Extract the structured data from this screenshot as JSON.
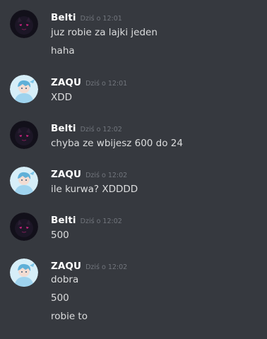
{
  "messages": [
    {
      "author": "Belti",
      "avatar": "dark-cat-avatar",
      "timestamp": "Dziś o 12:01",
      "lines": [
        "juz robie za lajki jeden",
        "haha"
      ]
    },
    {
      "author": "ZAQU",
      "avatar": "light-anime-avatar",
      "timestamp": "Dziś o 12:01",
      "lines": [
        "XDD"
      ]
    },
    {
      "author": "Belti",
      "avatar": "dark-cat-avatar",
      "timestamp": "Dziś o 12:02",
      "lines": [
        "chyba ze wbijesz 600 do 24"
      ]
    },
    {
      "author": "ZAQU",
      "avatar": "light-anime-avatar",
      "timestamp": "Dziś o 12:02",
      "lines": [
        "ile kurwa? XDDDD"
      ]
    },
    {
      "author": "Belti",
      "avatar": "dark-cat-avatar",
      "timestamp": "Dziś o 12:02",
      "lines": [
        "500"
      ]
    },
    {
      "author": "ZAQU",
      "avatar": "light-anime-avatar",
      "timestamp": "Dziś o 12:02",
      "lines": [
        "dobra",
        "500",
        "robie to"
      ]
    }
  ],
  "colors": {
    "background": "#36393f",
    "username": "#ffffff",
    "timestamp": "#72767d",
    "message_text": "#dcddde"
  }
}
